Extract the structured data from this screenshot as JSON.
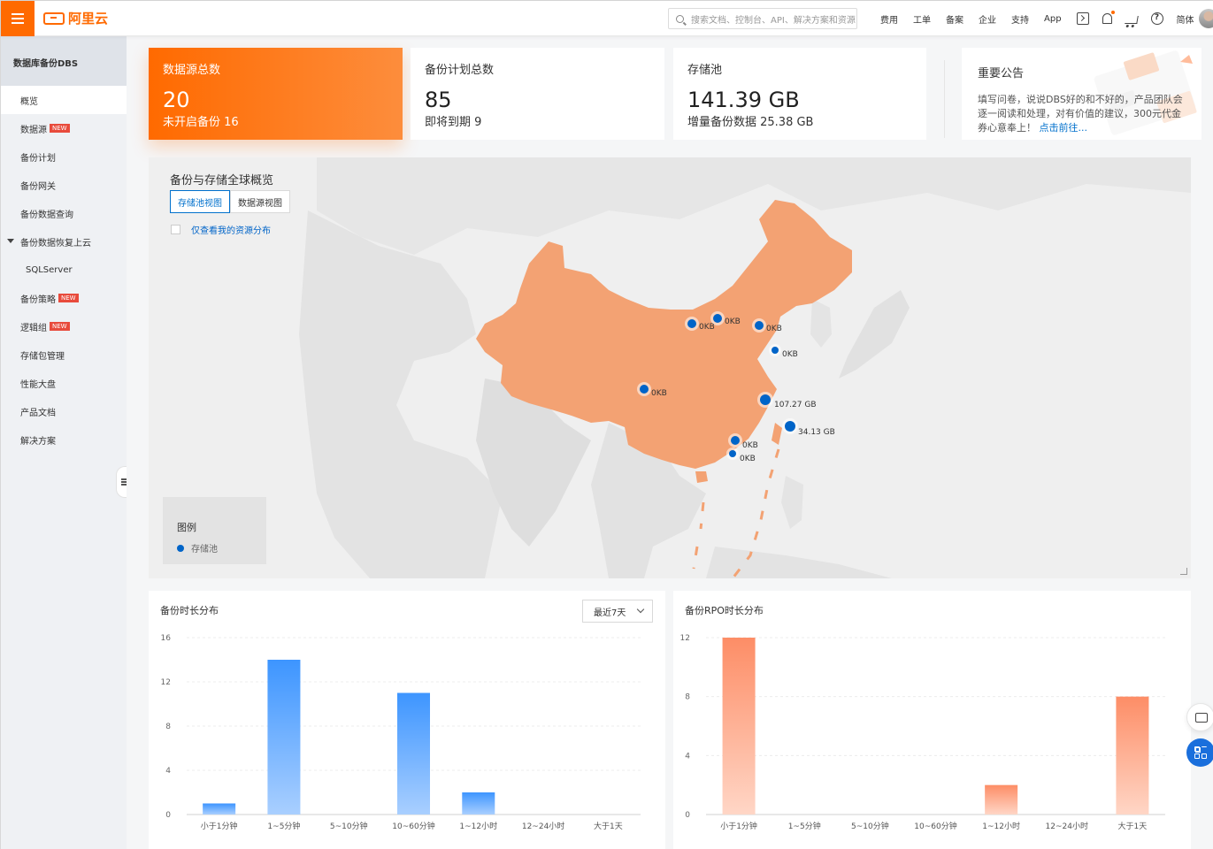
{
  "topbar": {
    "brand": "阿里云",
    "search_placeholder": "搜索文档、控制台、API、解决方案和资源",
    "nav": [
      "费用",
      "工单",
      "备案",
      "企业",
      "支持",
      "App"
    ],
    "lang": "简体"
  },
  "sidebar": {
    "title": "数据库备份DBS",
    "items": [
      {
        "label": "概览",
        "active": true
      },
      {
        "label": "数据源",
        "badge": "NEW"
      },
      {
        "label": "备份计划"
      },
      {
        "label": "备份网关"
      },
      {
        "label": "备份数据查询"
      },
      {
        "label": "备份数据恢复上云",
        "expanded": true
      },
      {
        "label": "SQLServer",
        "sub": true
      },
      {
        "label": "备份策略",
        "badge": "NEW"
      },
      {
        "label": "逻辑组",
        "badge": "NEW"
      },
      {
        "label": "存储包管理"
      },
      {
        "label": "性能大盘"
      },
      {
        "label": "产品文档"
      },
      {
        "label": "解决方案"
      }
    ]
  },
  "stats": [
    {
      "title": "数据源总数",
      "value": "20",
      "sub": "未开启备份 16"
    },
    {
      "title": "备份计划总数",
      "value": "85",
      "sub": "即将到期 9"
    },
    {
      "title": "存储池",
      "value": "141.39 GB",
      "sub": "增量备份数据 25.38 GB"
    }
  ],
  "notice": {
    "title": "重要公告",
    "text": "填写问卷，说说DBS好的和不好的，产品团队会逐一阅读和处理，对有价值的建议，300元代金券心意奉上！",
    "link": "点击前往..."
  },
  "map": {
    "title": "备份与存储全球概览",
    "tabs": [
      "存储池视图",
      "数据源视图"
    ],
    "checkbox_label": "仅查看我的资源分布",
    "legend_title": "图例",
    "legend_item": "存储池",
    "colors": {
      "china": "#f3a273",
      "land": "#e0e0e0",
      "dot": "#0064c8"
    },
    "points": [
      {
        "label": "0KB"
      },
      {
        "label": "0KB"
      },
      {
        "label": "0KB"
      },
      {
        "label": "0KB"
      },
      {
        "label": "0KB"
      },
      {
        "label": "107.27 GB"
      },
      {
        "label": "34.13 GB"
      },
      {
        "label": "0KB"
      },
      {
        "label": "0KB"
      }
    ]
  },
  "chart_data": [
    {
      "type": "bar",
      "title": "备份时长分布",
      "filter": "最近7天",
      "categories": [
        "小于1分钟",
        "1~5分钟",
        "5~10分钟",
        "10~60分钟",
        "1~12小时",
        "12~24小时",
        "大于1天"
      ],
      "values": [
        1,
        14,
        0,
        11,
        2,
        0,
        0
      ],
      "ylim": [
        0,
        16
      ],
      "yticks": [
        0,
        4,
        8,
        12,
        16
      ],
      "color": "#3d95ff",
      "grid": true
    },
    {
      "type": "bar",
      "title": "备份RPO时长分布",
      "categories": [
        "小于1分钟",
        "1~5分钟",
        "5~10分钟",
        "10~60分钟",
        "1~12小时",
        "12~24小时",
        "大于1天"
      ],
      "values": [
        12,
        0,
        0,
        0,
        2,
        0,
        8
      ],
      "ylim": [
        0,
        12
      ],
      "yticks": [
        0,
        4,
        8,
        12
      ],
      "color": "#fd8d66",
      "grid": true
    }
  ]
}
